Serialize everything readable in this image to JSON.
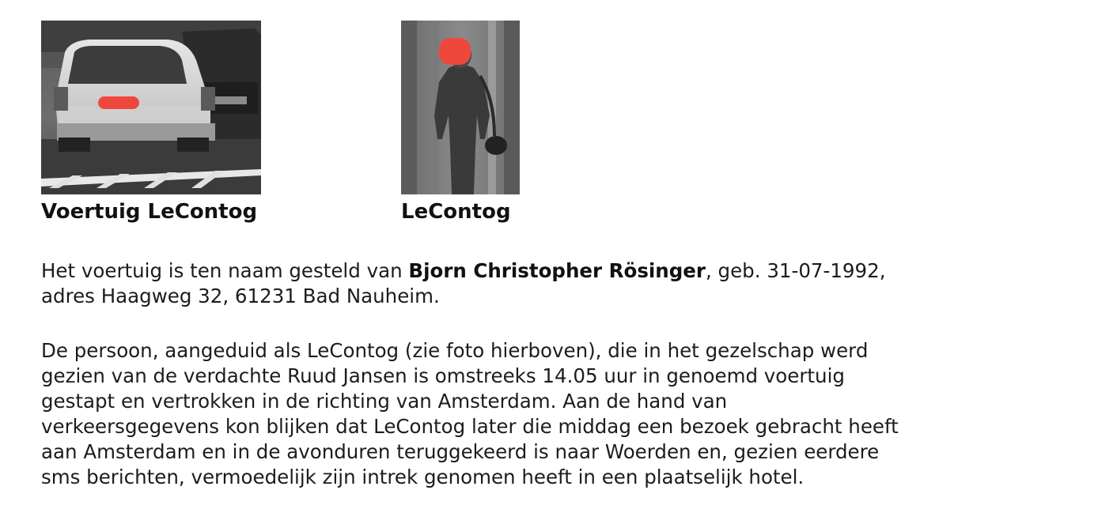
{
  "photos": [
    {
      "caption": "Voertuig LeContog",
      "image": "car-photo-redacted-plate"
    },
    {
      "caption": "LeContog",
      "image": "person-photo-redacted-face"
    }
  ],
  "paragraph1": {
    "prefix": "Het voertuig is ten naam gesteld van ",
    "name": "Bjorn Christopher Rösinger",
    "suffix": ", geb. 31-07-1992,",
    "line2": "adres Haagweg 32, 61231 Bad Nauheim."
  },
  "paragraph2": {
    "lines": [
      "De persoon, aangeduid als LeContog (zie foto hierboven), die in het gezelschap werd",
      "gezien van de verdachte Ruud Jansen is omstreeks 14.05 uur in genoemd voertuig",
      "gestapt en vertrokken in de richting van Amsterdam. Aan de hand van",
      "verkeersgegevens kon blijken dat LeContog later die middag een bezoek gebracht heeft",
      "aan Amsterdam en in de avonduren teruggekeerd is naar Woerden en, gezien eerdere",
      "sms berichten, vermoedelijk zijn intrek genomen heeft in een plaatselijk hotel."
    ]
  },
  "colors": {
    "redaction": "#f0473c",
    "text": "#1c1c1c"
  }
}
